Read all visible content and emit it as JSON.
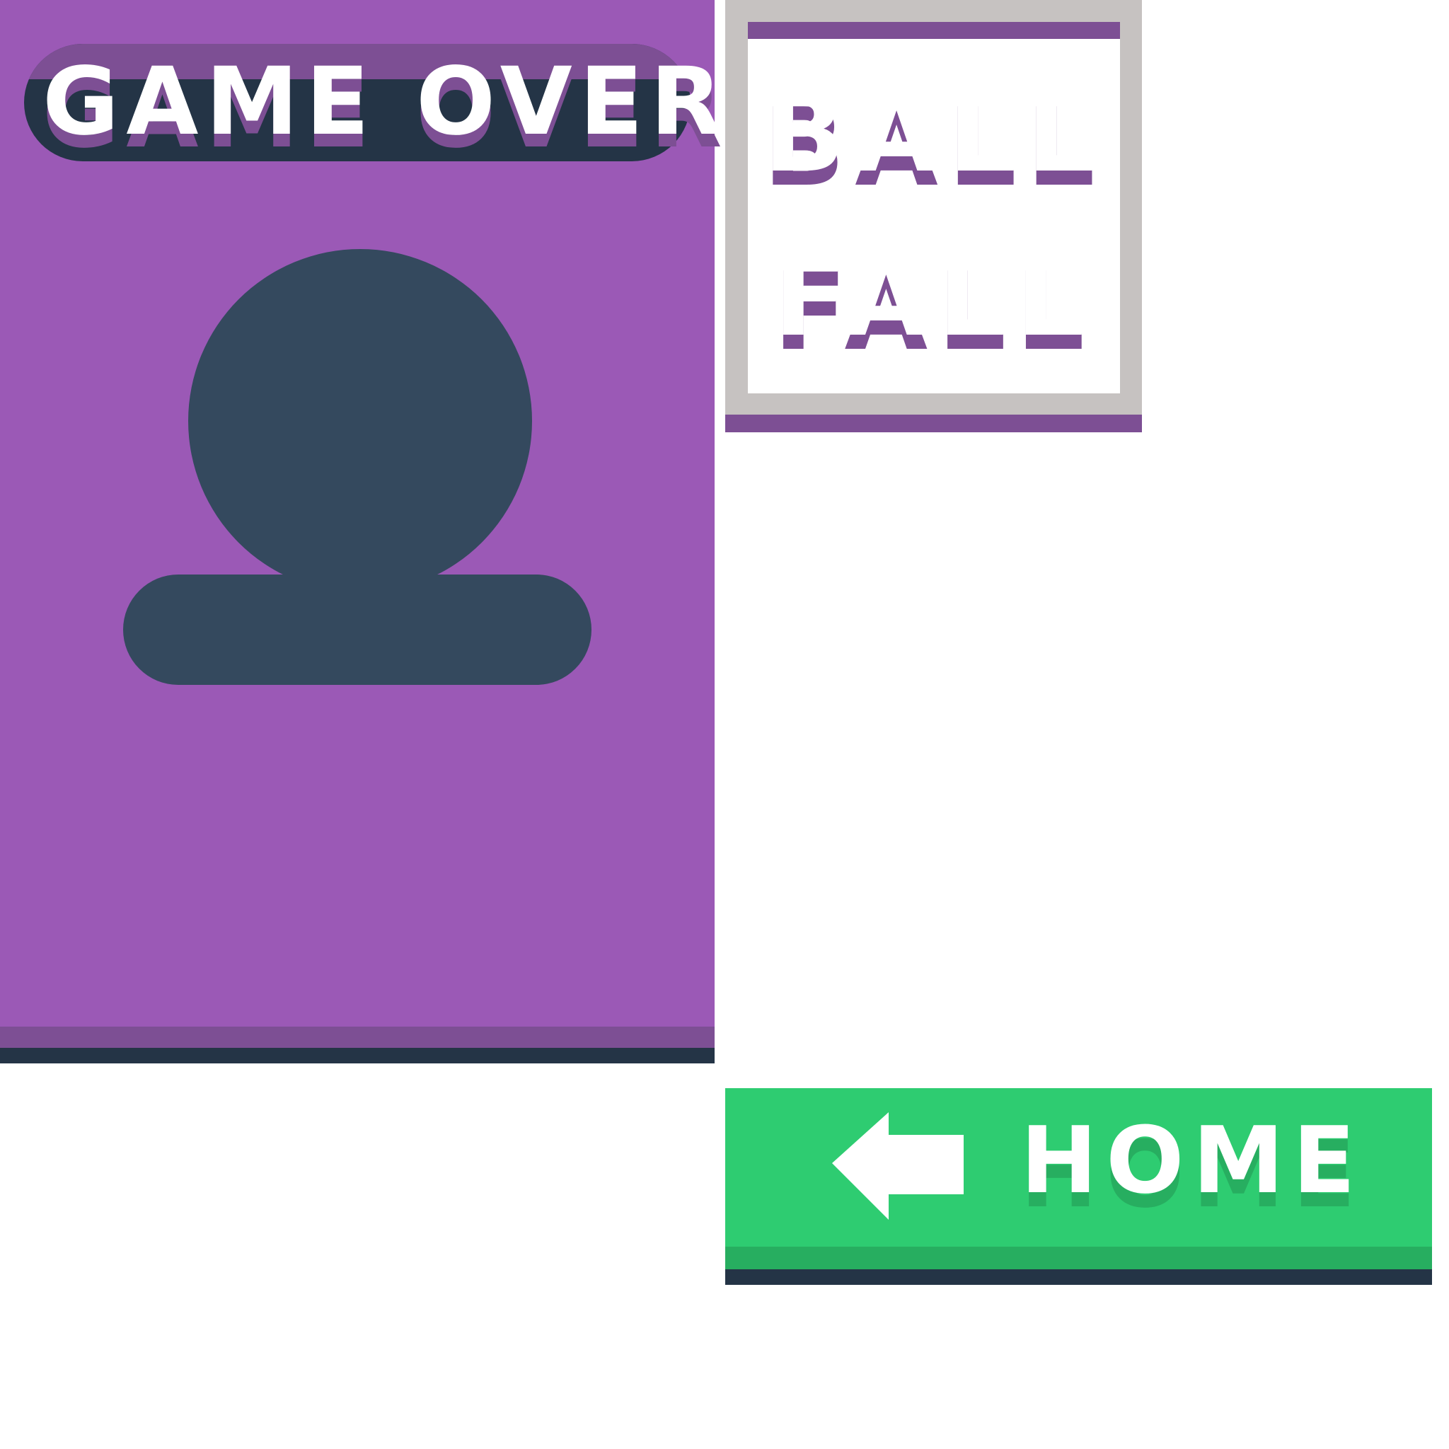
{
  "game_over": {
    "title": "GAME OVER"
  },
  "logo": {
    "line1": "BALL",
    "line2": "FALL"
  },
  "home_button": {
    "label": "HOME",
    "icon": "arrow-left-icon"
  },
  "colors": {
    "panel_purple": "#9b59b6",
    "dark_purple": "#7d4f94",
    "navy": "#243446",
    "figure_slate": "#34495e",
    "card_gray": "#c6c2c1",
    "home_green": "#2ecc71",
    "home_green_dark": "#27ae60",
    "text_white": "#ffffff"
  }
}
